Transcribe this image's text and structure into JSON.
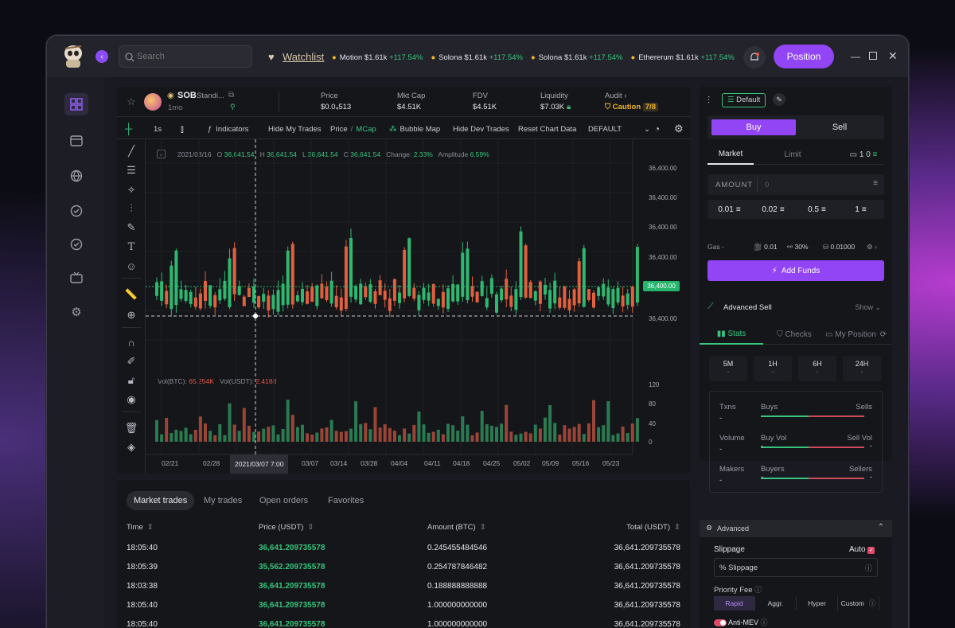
{
  "search": {
    "placeholder": "Search"
  },
  "watchlist": {
    "label": "Watchlist",
    "items": [
      {
        "name": "Motion",
        "price": "$1.61k",
        "change": "+117.54%"
      },
      {
        "name": "Solona",
        "price": "$1.61k",
        "change": "+117.54%"
      },
      {
        "name": "Solona",
        "price": "$1.61k",
        "change": "+117.54%"
      },
      {
        "name": "Ethererum",
        "price": "$1.61k",
        "change": "+117.54%"
      }
    ]
  },
  "header": {
    "position_label": "Position"
  },
  "token": {
    "symbol": "SOB",
    "name": "Standi...",
    "age": "1mo",
    "stats": [
      {
        "label": "Price",
        "value": "$0.0₄513"
      },
      {
        "label": "Mkt Cap",
        "value": "$4.51K"
      },
      {
        "label": "FDV",
        "value": "$4.51K"
      },
      {
        "label": "Liquidity",
        "value": "$7.03K"
      }
    ],
    "audit_label": "Audit",
    "caution_label": "Caution",
    "caution_score": "7/8"
  },
  "toolbar": {
    "interval": "1s",
    "indicators": "Indicators",
    "hide_my_trades": "Hide My Trades",
    "price": "Price",
    "mcap": "MCap",
    "bubble_map": "Bubble Map",
    "hide_dev_trades": "Hide Dev Trades",
    "reset_chart": "Reset Chart Data",
    "layout": "DEFAULT"
  },
  "ohlc": {
    "date": "2021/03/16",
    "o_label": "O",
    "o": "36,641.54",
    "h_label": "H",
    "h": "36,641.54",
    "l_label": "L",
    "l": "36,641.54",
    "c_label": "C",
    "c": "36,641.54",
    "change_label": "Change:",
    "change": "2.33%",
    "amp_label": "Amplitude",
    "amp": "6.59%"
  },
  "volume": {
    "btc_label": "Vol(BTC):",
    "btc": "65.254K",
    "usdt_label": "Vol(USDT):",
    "usdt": "2.4188"
  },
  "chart_data": {
    "type": "candlestick",
    "price_ticks": [
      "36,400.00",
      "36,400.00",
      "36,400.00",
      "36,400.00",
      "36,400.00",
      "36,400.00"
    ],
    "current_price": "36,400.00",
    "volume_ticks": [
      "120",
      "80",
      "40",
      "0"
    ],
    "x_ticks": [
      "02/21",
      "02/28",
      "03/07",
      "03/14",
      "03/28",
      "04/04",
      "04/11",
      "04/18",
      "04/25",
      "05/02",
      "05/09",
      "05/16",
      "05/23"
    ],
    "crosshair_label": "2021/03/07 7:00"
  },
  "trades": {
    "tabs": [
      "Market trades",
      "My trades",
      "Open orders",
      "Favorites"
    ],
    "columns": [
      "Time",
      "Price (USDT)",
      "Amount (BTC)",
      "Total (USDT)"
    ],
    "rows": [
      {
        "time": "18:05:40",
        "price": "36,641.209735578",
        "amount": "0.245455484546",
        "total": "36,641.209735578"
      },
      {
        "time": "18:05:39",
        "price": "35,562.209735578",
        "amount": "0.254787846482",
        "total": "36,641.209735578"
      },
      {
        "time": "18:03:38",
        "price": "36,641.209735578",
        "amount": "0.188888888888",
        "total": "36,641.209735578"
      },
      {
        "time": "18:05:40",
        "price": "36,641.209735578",
        "amount": "1.000000000000",
        "total": "36,641.209735578"
      },
      {
        "time": "18:05:40",
        "price": "36,641.209735578",
        "amount": "1.000000000000",
        "total": "36,641.209735578"
      }
    ]
  },
  "order": {
    "preset": "Default",
    "buy": "Buy",
    "sell": "Sell",
    "market": "Market",
    "limit": "Limit",
    "wallet_count": "1",
    "balance": "0",
    "amount_label": "AMOUNT",
    "amount_placeholder": "0",
    "quick": [
      "0.01",
      "0.02",
      "0.5",
      "1"
    ],
    "gas_label": "Gas -",
    "gas_values": [
      "0.01",
      "30%",
      "0.01000"
    ],
    "add_funds": "Add Funds",
    "advanced_sell": "Advanced Sell",
    "show": "Show"
  },
  "stats": {
    "tabs": [
      "Stats",
      "Checks",
      "My Position"
    ],
    "periods": [
      {
        "label": "5M",
        "value": "-"
      },
      {
        "label": "1H",
        "value": "-"
      },
      {
        "label": "6H",
        "value": "-"
      },
      {
        "label": "24H",
        "value": "-"
      }
    ],
    "rows": [
      {
        "left": "Txns",
        "left_val": "-",
        "a": "Buys",
        "b": "Sells",
        "a_val": "",
        "b_val": ""
      },
      {
        "left": "Volume",
        "left_val": "-",
        "a": "Buy Vol",
        "b": "Sell Vol",
        "a_val": "-",
        "b_val": "-"
      },
      {
        "left": "Makers",
        "left_val": "-",
        "a": "Buyers",
        "b": "Sellers",
        "a_val": "-",
        "b_val": "-"
      }
    ]
  },
  "advanced": {
    "label": "Advanced",
    "slippage": "Slippage",
    "auto": "Auto",
    "slippage_placeholder": "Slippage",
    "priority_fee": "Priority Fee",
    "fees": [
      "Rapid",
      "Aggr.",
      "Hyper",
      "Custom"
    ],
    "anti_mev": "Anti-MEV"
  }
}
